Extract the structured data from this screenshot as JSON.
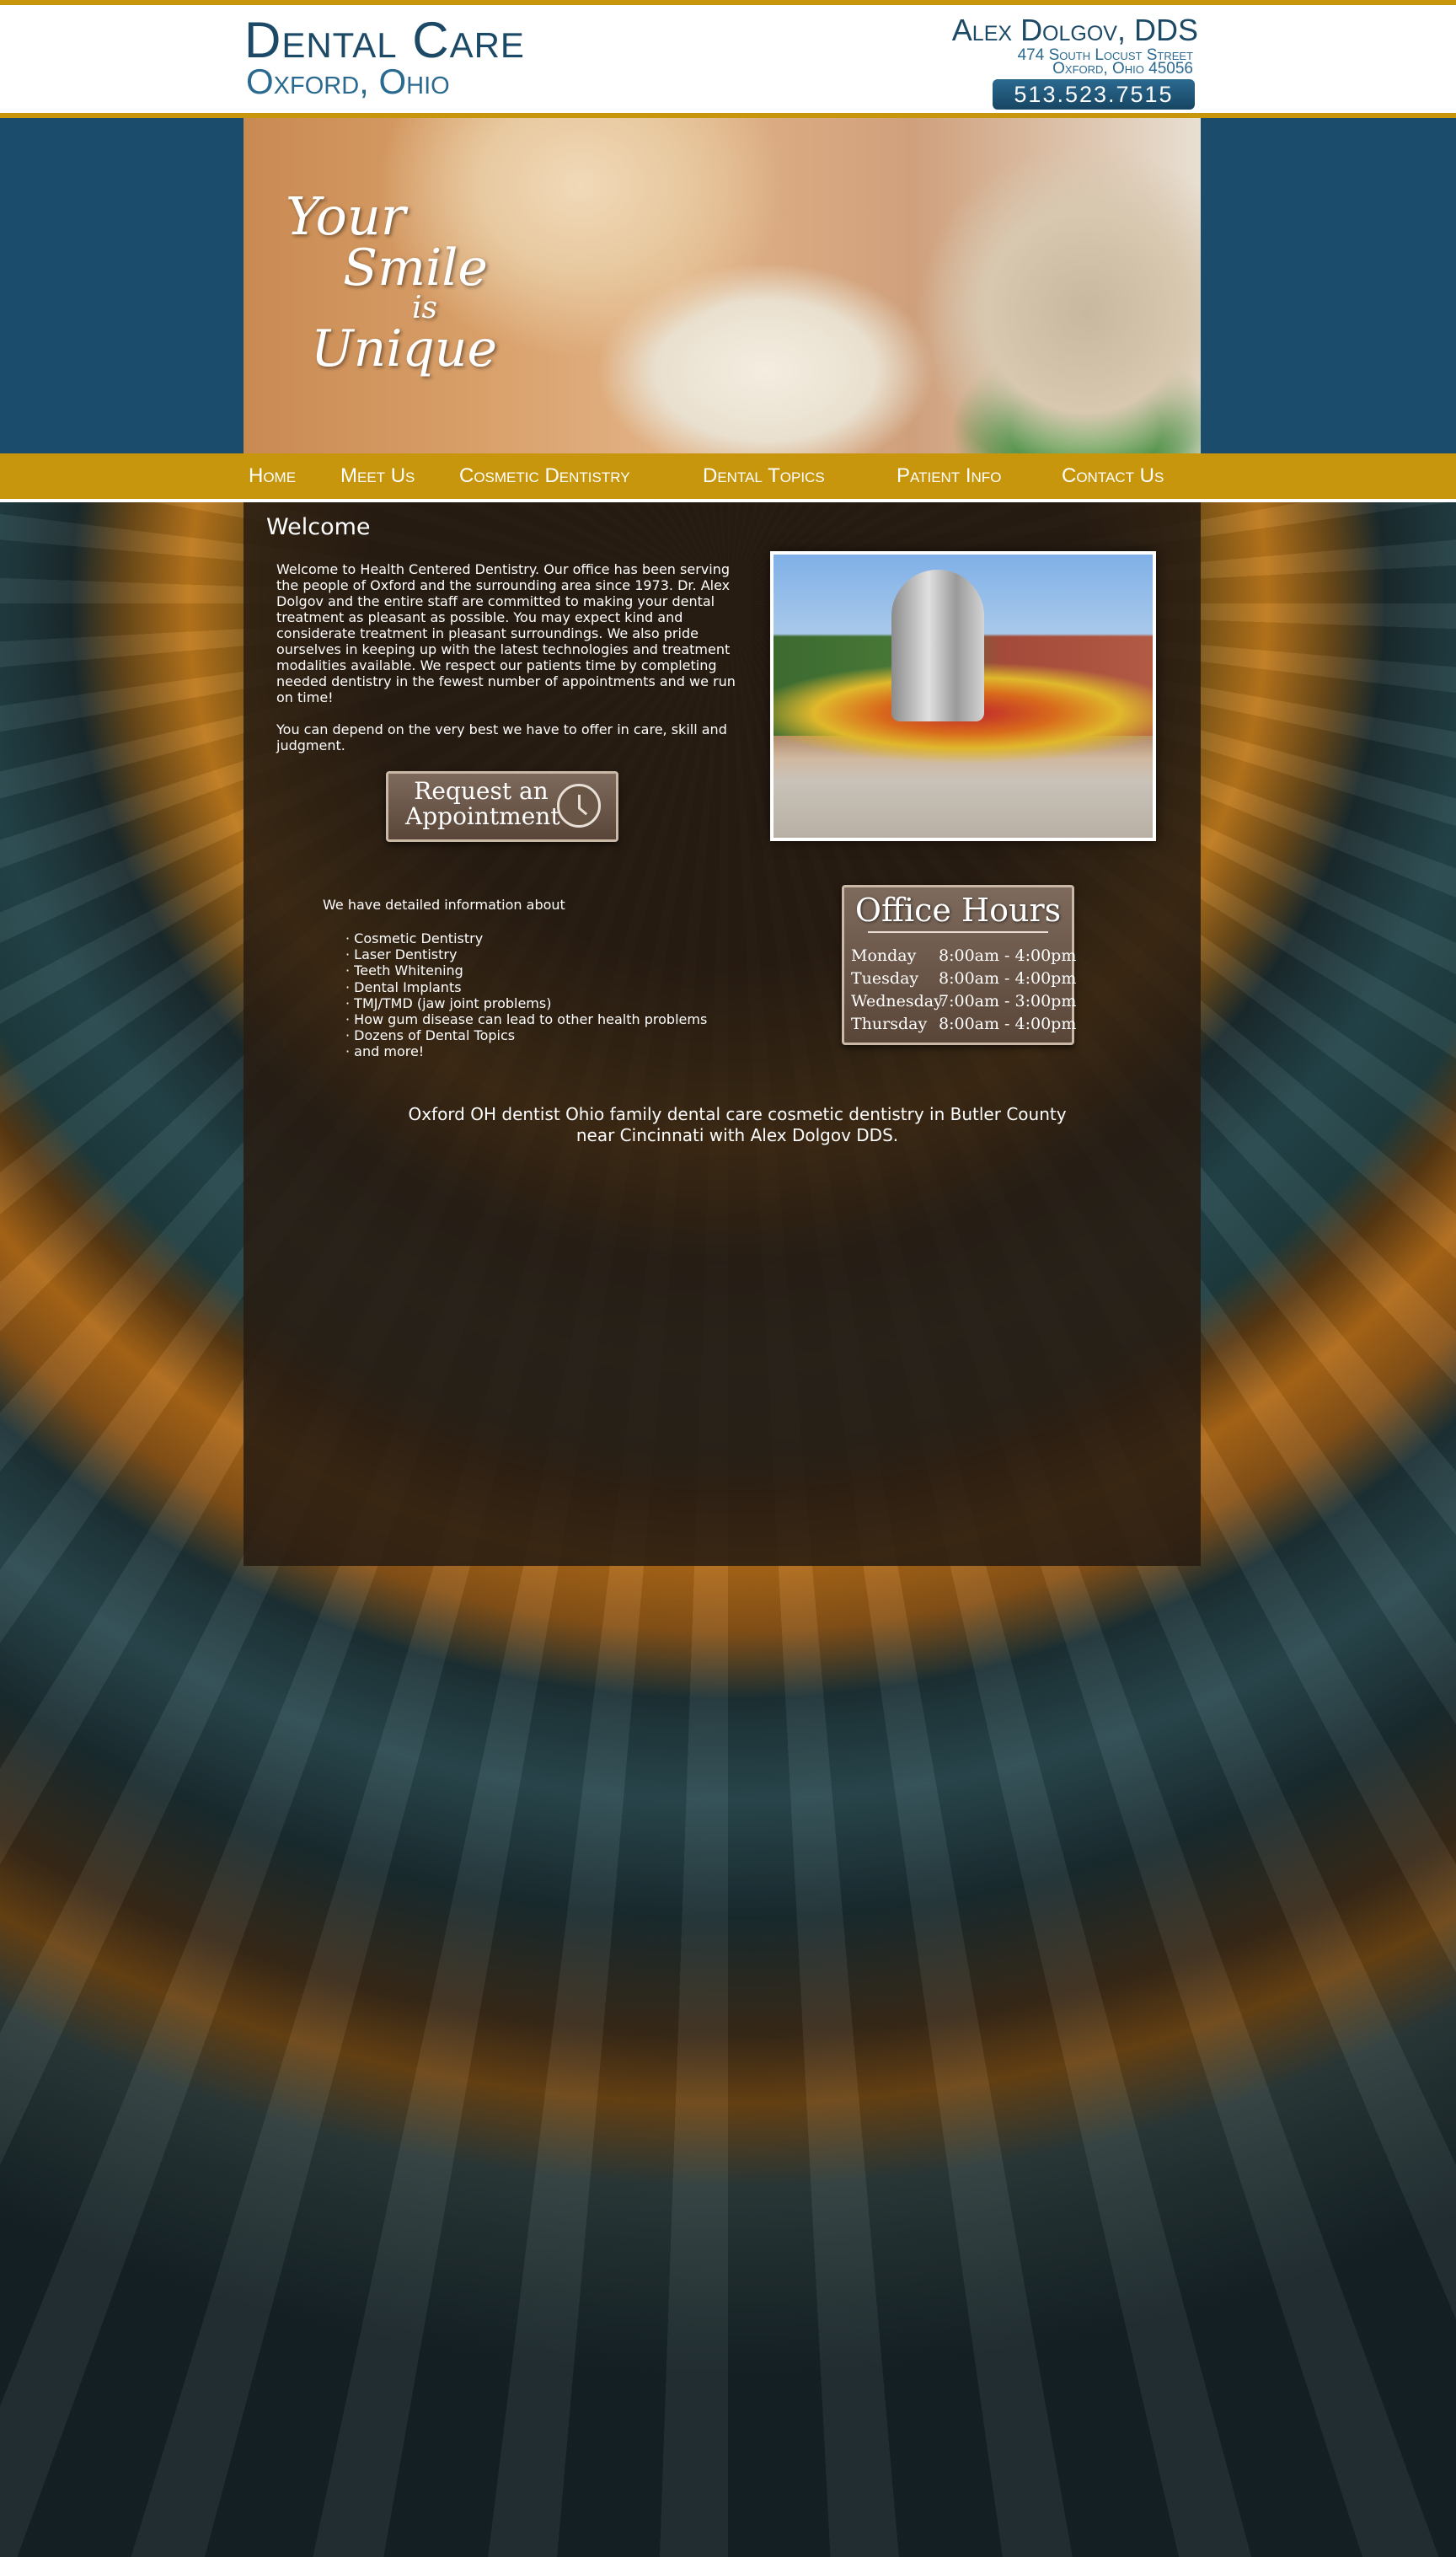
{
  "header": {
    "brand_title": "Dental Care",
    "brand_sub": "Oxford, Ohio",
    "doctor": "Alex Dolgov, DDS",
    "address_line1": "474 South Locust Street",
    "address_line2": "Oxford, Ohio 45056",
    "phone": "513.523.7515"
  },
  "hero": {
    "line1": "Your",
    "line2": "Smile",
    "line3": "is",
    "line4": "Unique"
  },
  "nav": {
    "items": [
      "Home",
      "Meet Us",
      "Cosmetic Dentistry",
      "Dental Topics",
      "Patient Info",
      "Contact Us"
    ]
  },
  "main": {
    "title": "Welcome",
    "paragraph1": "Welcome to Health Centered Dentistry. Our office has been serving the people of Oxford and the surrounding area since 1973. Dr. Alex Dolgov and the entire staff are committed to making your dental treatment as pleasant as possible. You may expect kind and considerate treatment in pleasant surroundings. We also pride ourselves in keeping up with the latest technologies and treatment modalities available. We respect our patients time by completing needed dentistry in the fewest number of appointments and we run on time!",
    "paragraph2": "You can depend on the very best we have to offer in care, skill and judgment.",
    "appointment_button": "Request an Appointment",
    "info_intro": "We have detailed information about",
    "info_items": [
      "Cosmetic Dentistry",
      "Laser Dentistry",
      "Teeth Whitening",
      "Dental Implants",
      "TMJ/TMD (jaw joint problems)",
      "How gum disease can lead to other health problems",
      "Dozens of Dental Topics",
      "and more!"
    ],
    "office_hours": {
      "title": "Office Hours",
      "rows": [
        {
          "day": "Monday",
          "time": "8:00am - 4:00pm"
        },
        {
          "day": "Tuesday",
          "time": "8:00am - 4:00pm"
        },
        {
          "day": "Wednesday",
          "time": "7:00am - 3:00pm"
        },
        {
          "day": "Thursday",
          "time": "8:00am - 4:00pm"
        }
      ]
    },
    "footer_text": "Oxford OH dentist Ohio family dental care cosmetic dentistry in Butler County near Cincinnati with Alex Dolgov DDS."
  },
  "colors": {
    "gold_accent": "#c8960c",
    "navy_brand": "#1c4a66",
    "panel_brown": "#281c12"
  }
}
